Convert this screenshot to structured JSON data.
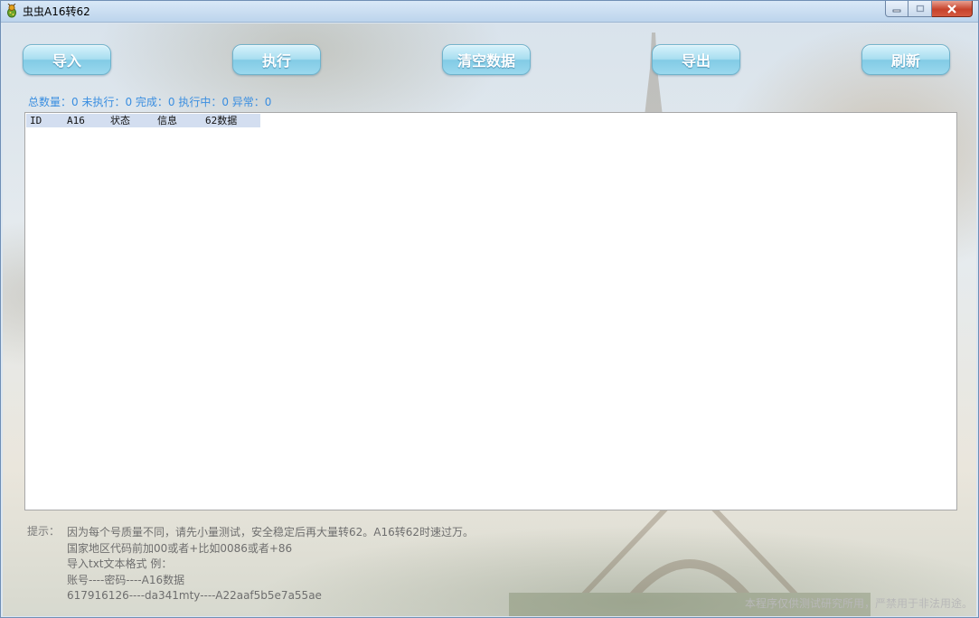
{
  "window": {
    "title": "虫虫A16转62",
    "icon": "bug-app-icon"
  },
  "toolbar": {
    "import_label": "导入",
    "execute_label": "执行",
    "clear_label": "清空数据",
    "export_label": "导出",
    "refresh_label": "刷新"
  },
  "stats": {
    "text": "总数量：0 未执行：0 完成：0 执行中：0 异常：0"
  },
  "table": {
    "columns": [
      "ID",
      "A16",
      "状态",
      "信息",
      "62数据"
    ],
    "rows": []
  },
  "tips": {
    "label": "提示：",
    "lines": [
      "因为每个号质量不同，请先小量测试，安全稳定后再大量转62。A16转62时速过万。",
      "国家地区代码前加00或者+比如0086或者+86",
      "导入txt文本格式  例：",
      "账号----密码----A16数据",
      "617916126----da341mty----A22aaf5b5e7a55ae"
    ]
  },
  "disclaimer": "本程序仅供测试研究所用，严禁用于非法用途。",
  "colors": {
    "accent_text": "#3a8ee0",
    "button_top": "#d6f2fb",
    "button_bottom": "#82cbe5",
    "header_bg": "#d3def0"
  }
}
